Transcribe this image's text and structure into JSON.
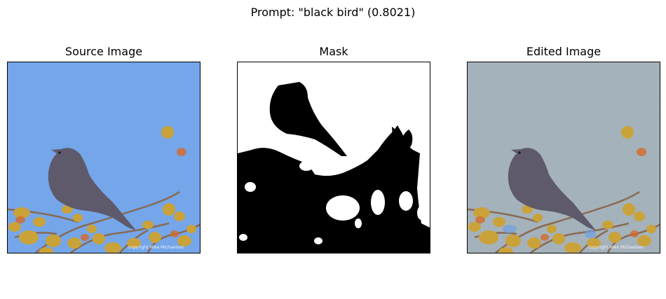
{
  "figure": {
    "title": "Prompt: \"black bird\" (0.8021)"
  },
  "panels": [
    {
      "title": "Source Image",
      "watermark": "copyright Mike Michaelsen"
    },
    {
      "title": "Mask"
    },
    {
      "title": "Edited Image",
      "watermark": "copyright Mike Michaelsen"
    }
  ],
  "colors": {
    "sky_source": "#74a6e9",
    "sky_edited": "#9fb0bb",
    "bird": "#5e5a6c",
    "mask_fg": "#000000",
    "mask_bg": "#ffffff"
  }
}
